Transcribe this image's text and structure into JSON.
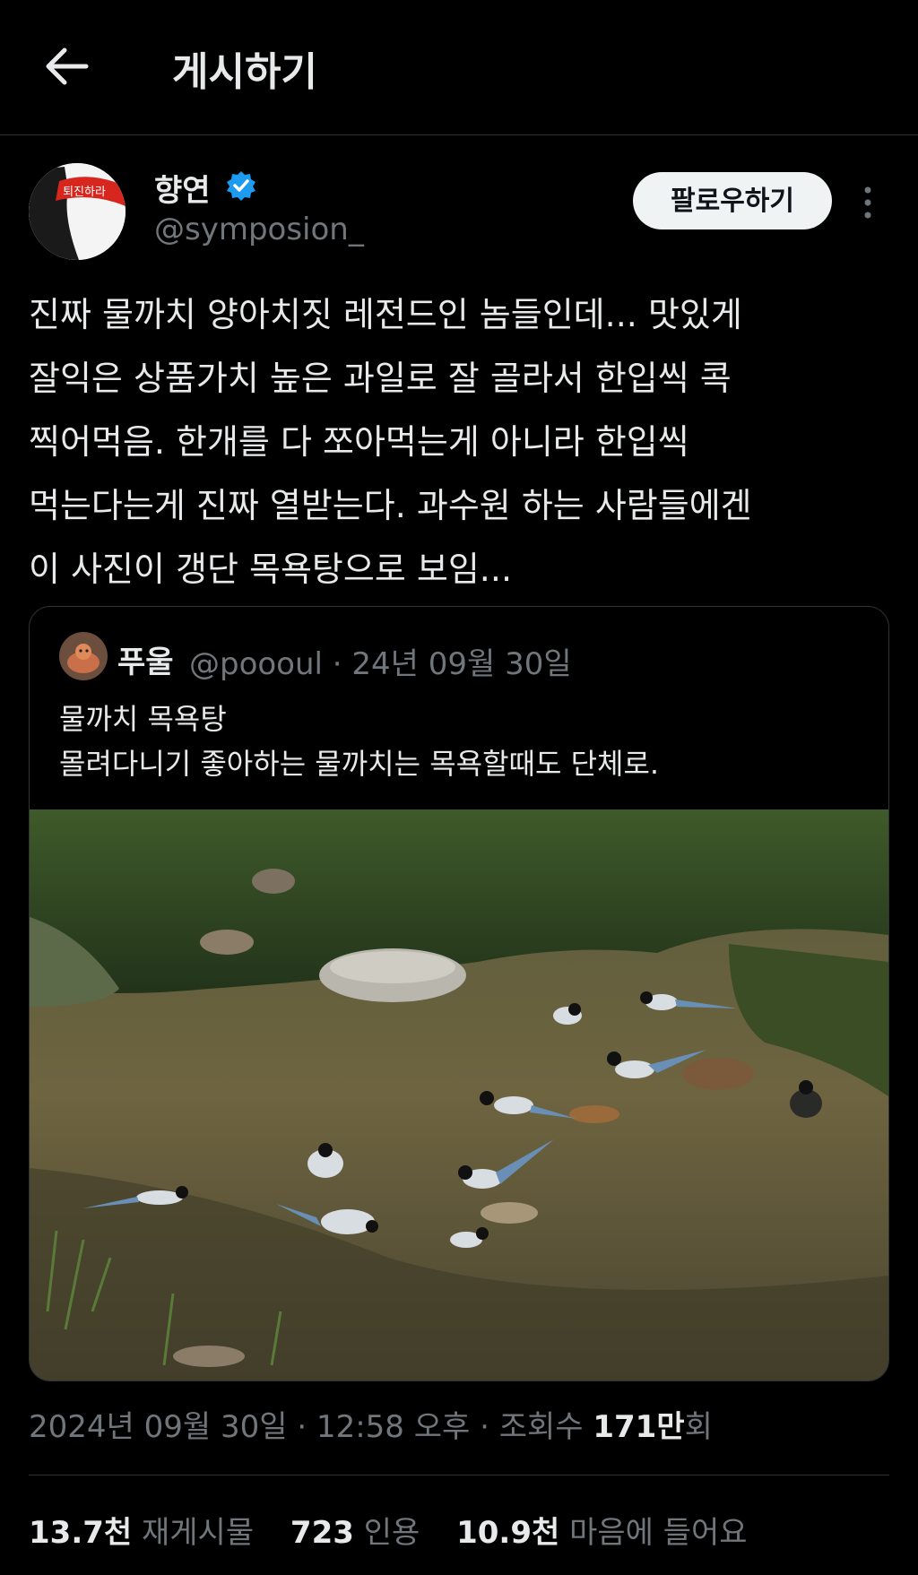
{
  "header": {
    "title": "게시하기",
    "back_icon": "arrow-left-icon"
  },
  "author": {
    "name": "향연",
    "handle": "@symposion_",
    "avatar_headband_text": "퇴진하라",
    "verified_color": "#1d9bf0",
    "follow_label": "팔로우하기",
    "more_icon": "more-vertical-icon"
  },
  "post": {
    "lines": [
      "진짜 물까치 양아치짓 레전드인 놈들인데... 맛있게",
      "잘익은 상품가치 높은 과일로 잘 골라서 한입씩 콕",
      "찍어먹음. 한개를 다 쪼아먹는게 아니라 한입씩",
      "먹는다는게 진짜 열받는다. 과수원 하는 사람들에겐",
      "이 사진이 갱단 목욕탕으로 보임..."
    ]
  },
  "quoted": {
    "name": "푸울",
    "meta": "@poooul · 24년 09월 30일",
    "lines": [
      "물까치 목욕탕",
      "몰려다니기 좋아하는 물까치는 목욕할때도 단체로."
    ]
  },
  "timestamp": {
    "prefix": "2024년 09월 30일 · 12:58 오후 · 조회수 ",
    "views": "171만",
    "suffix": "회"
  },
  "stats": {
    "reposts_count": "13.7천",
    "reposts_label": "재게시물",
    "quotes_count": "723",
    "quotes_label": "인용",
    "likes_count": "10.9천",
    "likes_label": "마음에 들어요"
  }
}
